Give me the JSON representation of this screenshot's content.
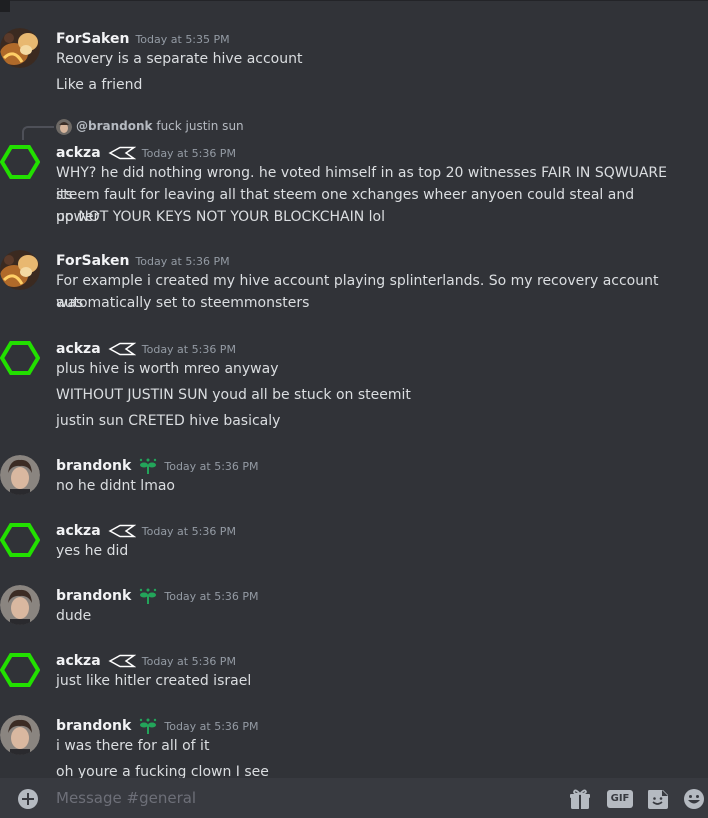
{
  "messages": [
    {
      "author": "ForSaken",
      "time": "Today at 5:35 PM",
      "lines": [
        "Reovery is a separate hive account",
        "Like a friend"
      ]
    },
    {
      "reply": {
        "user": "@brandonk",
        "text": "fuck justin sun"
      },
      "author": "ackza",
      "time": "Today at 5:36 PM",
      "lines": [
        "WHY? he did nothing wrong. he voted himself in as top 20 witnesses FAIR IN SQWUARE its",
        "steem fault for leaving all that steem one xchanges wheer anyoen could steal and power",
        "up NOT YOUR KEYS NOT YOUR BLOCKCHAIN lol"
      ]
    },
    {
      "author": "ForSaken",
      "time": "Today at 5:36 PM",
      "lines": [
        "For example i created my hive account playing splinterlands. So my recovery account was",
        "automatically set to steemmonsters"
      ]
    },
    {
      "author": "ackza",
      "time": "Today at 5:36 PM",
      "lines": [
        "plus hive is worth mreo anyway",
        "WITHOUT JUSTIN SUN youd all be stuck on steemit",
        "justin sun CRETED hive basicaly"
      ]
    },
    {
      "author": "brandonk",
      "time": "Today at 5:36 PM",
      "lines": [
        "no he didnt lmao"
      ]
    },
    {
      "author": "ackza",
      "time": "Today at 5:36 PM",
      "lines": [
        "yes he did"
      ]
    },
    {
      "author": "brandonk",
      "time": "Today at 5:36 PM",
      "lines": [
        "dude"
      ]
    },
    {
      "author": "ackza",
      "time": "Today at 5:36 PM",
      "lines": [
        "just like hitler created israel"
      ]
    },
    {
      "author": "brandonk",
      "time": "Today at 5:36 PM",
      "lines": [
        "i was there for all of it",
        "oh youre a fucking clown I see"
      ]
    }
  ],
  "composer": {
    "placeholder": "Message #general",
    "gif_label": "GIF",
    "icons": [
      "add-attachment-icon",
      "gift-icon",
      "gif-icon",
      "sticker-icon",
      "emoji-icon"
    ]
  },
  "colors": {
    "background": "#313338",
    "hex_avatar": "#22e000",
    "badge": "#23a55a"
  }
}
